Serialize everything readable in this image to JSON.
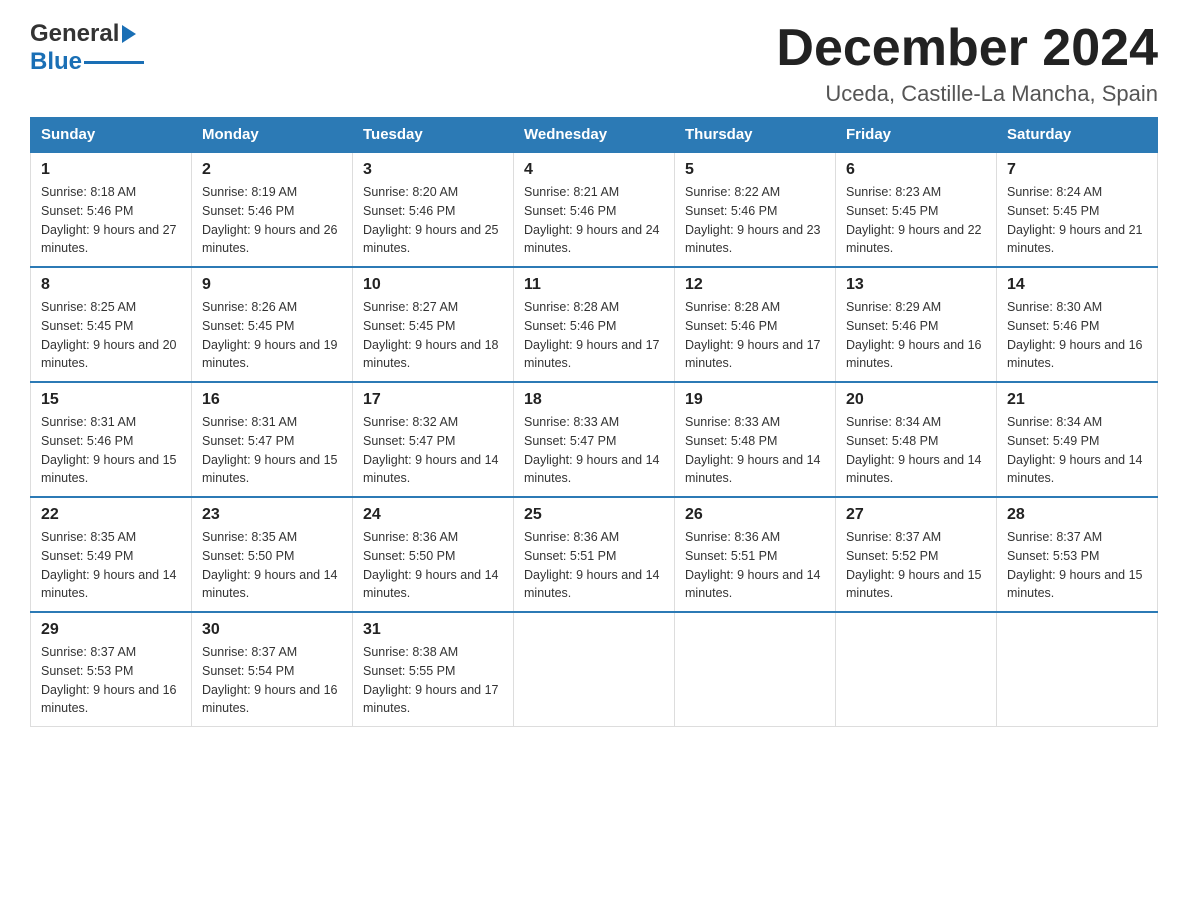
{
  "header": {
    "month_title": "December 2024",
    "subtitle": "Uceda, Castille-La Mancha, Spain",
    "logo_general": "General",
    "logo_blue": "Blue"
  },
  "days_of_week": [
    "Sunday",
    "Monday",
    "Tuesday",
    "Wednesday",
    "Thursday",
    "Friday",
    "Saturday"
  ],
  "weeks": [
    [
      {
        "day": "1",
        "sunrise": "8:18 AM",
        "sunset": "5:46 PM",
        "daylight": "9 hours and 27 minutes."
      },
      {
        "day": "2",
        "sunrise": "8:19 AM",
        "sunset": "5:46 PM",
        "daylight": "9 hours and 26 minutes."
      },
      {
        "day": "3",
        "sunrise": "8:20 AM",
        "sunset": "5:46 PM",
        "daylight": "9 hours and 25 minutes."
      },
      {
        "day": "4",
        "sunrise": "8:21 AM",
        "sunset": "5:46 PM",
        "daylight": "9 hours and 24 minutes."
      },
      {
        "day": "5",
        "sunrise": "8:22 AM",
        "sunset": "5:46 PM",
        "daylight": "9 hours and 23 minutes."
      },
      {
        "day": "6",
        "sunrise": "8:23 AM",
        "sunset": "5:45 PM",
        "daylight": "9 hours and 22 minutes."
      },
      {
        "day": "7",
        "sunrise": "8:24 AM",
        "sunset": "5:45 PM",
        "daylight": "9 hours and 21 minutes."
      }
    ],
    [
      {
        "day": "8",
        "sunrise": "8:25 AM",
        "sunset": "5:45 PM",
        "daylight": "9 hours and 20 minutes."
      },
      {
        "day": "9",
        "sunrise": "8:26 AM",
        "sunset": "5:45 PM",
        "daylight": "9 hours and 19 minutes."
      },
      {
        "day": "10",
        "sunrise": "8:27 AM",
        "sunset": "5:45 PM",
        "daylight": "9 hours and 18 minutes."
      },
      {
        "day": "11",
        "sunrise": "8:28 AM",
        "sunset": "5:46 PM",
        "daylight": "9 hours and 17 minutes."
      },
      {
        "day": "12",
        "sunrise": "8:28 AM",
        "sunset": "5:46 PM",
        "daylight": "9 hours and 17 minutes."
      },
      {
        "day": "13",
        "sunrise": "8:29 AM",
        "sunset": "5:46 PM",
        "daylight": "9 hours and 16 minutes."
      },
      {
        "day": "14",
        "sunrise": "8:30 AM",
        "sunset": "5:46 PM",
        "daylight": "9 hours and 16 minutes."
      }
    ],
    [
      {
        "day": "15",
        "sunrise": "8:31 AM",
        "sunset": "5:46 PM",
        "daylight": "9 hours and 15 minutes."
      },
      {
        "day": "16",
        "sunrise": "8:31 AM",
        "sunset": "5:47 PM",
        "daylight": "9 hours and 15 minutes."
      },
      {
        "day": "17",
        "sunrise": "8:32 AM",
        "sunset": "5:47 PM",
        "daylight": "9 hours and 14 minutes."
      },
      {
        "day": "18",
        "sunrise": "8:33 AM",
        "sunset": "5:47 PM",
        "daylight": "9 hours and 14 minutes."
      },
      {
        "day": "19",
        "sunrise": "8:33 AM",
        "sunset": "5:48 PM",
        "daylight": "9 hours and 14 minutes."
      },
      {
        "day": "20",
        "sunrise": "8:34 AM",
        "sunset": "5:48 PM",
        "daylight": "9 hours and 14 minutes."
      },
      {
        "day": "21",
        "sunrise": "8:34 AM",
        "sunset": "5:49 PM",
        "daylight": "9 hours and 14 minutes."
      }
    ],
    [
      {
        "day": "22",
        "sunrise": "8:35 AM",
        "sunset": "5:49 PM",
        "daylight": "9 hours and 14 minutes."
      },
      {
        "day": "23",
        "sunrise": "8:35 AM",
        "sunset": "5:50 PM",
        "daylight": "9 hours and 14 minutes."
      },
      {
        "day": "24",
        "sunrise": "8:36 AM",
        "sunset": "5:50 PM",
        "daylight": "9 hours and 14 minutes."
      },
      {
        "day": "25",
        "sunrise": "8:36 AM",
        "sunset": "5:51 PM",
        "daylight": "9 hours and 14 minutes."
      },
      {
        "day": "26",
        "sunrise": "8:36 AM",
        "sunset": "5:51 PM",
        "daylight": "9 hours and 14 minutes."
      },
      {
        "day": "27",
        "sunrise": "8:37 AM",
        "sunset": "5:52 PM",
        "daylight": "9 hours and 15 minutes."
      },
      {
        "day": "28",
        "sunrise": "8:37 AM",
        "sunset": "5:53 PM",
        "daylight": "9 hours and 15 minutes."
      }
    ],
    [
      {
        "day": "29",
        "sunrise": "8:37 AM",
        "sunset": "5:53 PM",
        "daylight": "9 hours and 16 minutes."
      },
      {
        "day": "30",
        "sunrise": "8:37 AM",
        "sunset": "5:54 PM",
        "daylight": "9 hours and 16 minutes."
      },
      {
        "day": "31",
        "sunrise": "8:38 AM",
        "sunset": "5:55 PM",
        "daylight": "9 hours and 17 minutes."
      },
      null,
      null,
      null,
      null
    ]
  ]
}
